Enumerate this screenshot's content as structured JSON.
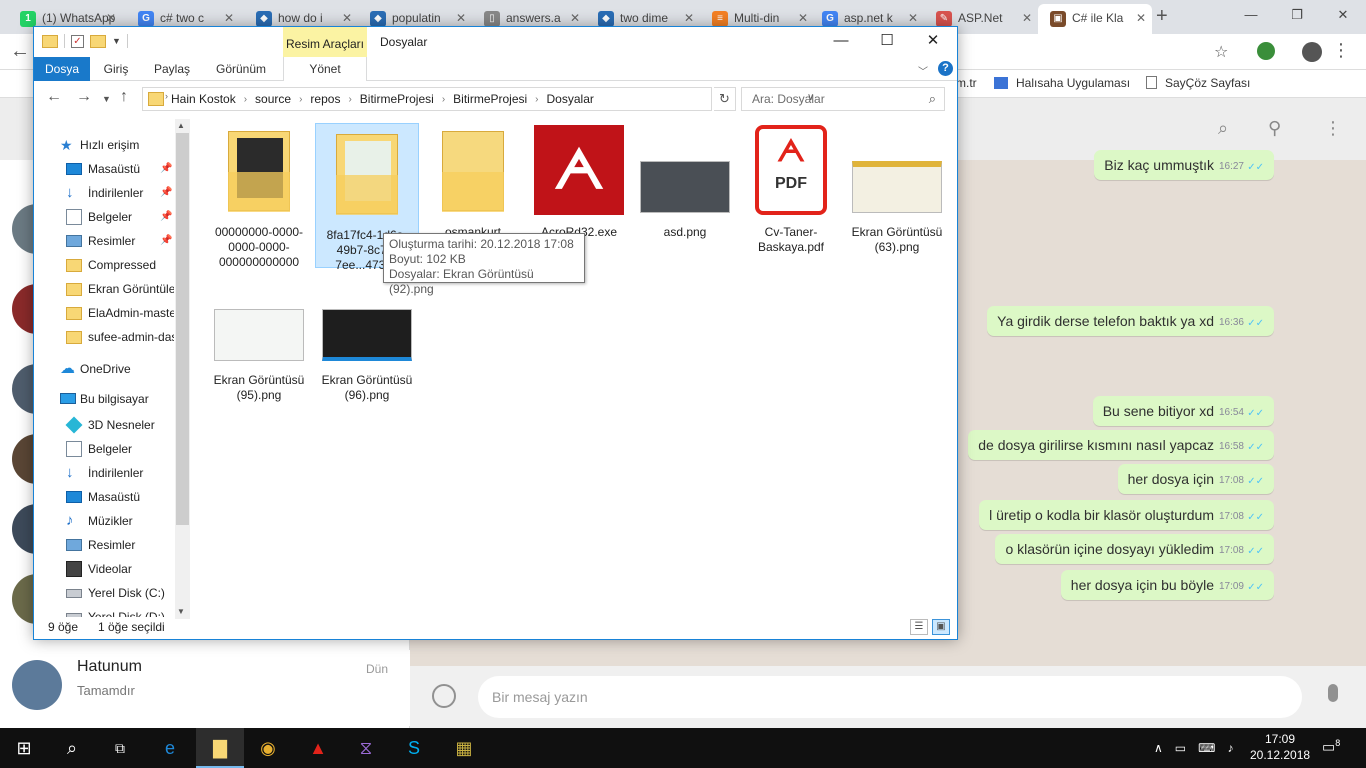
{
  "browser": {
    "tabs": [
      {
        "label": "(1) WhatsApp",
        "fav": "1",
        "color": "#25d366",
        "active": false
      },
      {
        "label": "c# two c",
        "fav": "G",
        "color": "#4285f4",
        "active": false
      },
      {
        "label": "how do i",
        "fav": "◆",
        "color": "#2a6db5",
        "active": false
      },
      {
        "label": "populatin",
        "fav": "◆",
        "color": "#2a6db5",
        "active": false
      },
      {
        "label": "answers.a",
        "fav": "▯",
        "color": "#888888",
        "active": false
      },
      {
        "label": "two dime",
        "fav": "◆",
        "color": "#2a6db5",
        "active": false
      },
      {
        "label": "Multi-din",
        "fav": "≡",
        "color": "#f48024",
        "active": false
      },
      {
        "label": "asp.net k",
        "fav": "G",
        "color": "#4285f4",
        "active": false
      },
      {
        "label": "ASP.Net",
        "fav": "✎",
        "color": "#d9534f",
        "active": false
      },
      {
        "label": "C# ile Kla",
        "fav": "▣",
        "color": "#7a4b2a",
        "active": true
      }
    ],
    "new_tab": "+",
    "bookmarks": [
      "m.tr",
      "Halısaha Uygulaması",
      "SayÇöz Sayfası"
    ]
  },
  "whatsapp": {
    "chat": {
      "name": "Hatunum",
      "preview": "Tamamdır",
      "time": "Dün"
    },
    "messages": [
      {
        "text": "Biz kaç ummuştık",
        "time": "16:27"
      },
      {
        "text": "Ya girdik derse telefon baktık ya xd",
        "time": "16:36"
      },
      {
        "text": "Bu sene bitiyor xd",
        "time": "16:54"
      },
      {
        "text": "de dosya girilirse kısmını nasıl yapcaz",
        "time": "16:58"
      },
      {
        "text": "her dosya için",
        "time": "17:08"
      },
      {
        "text": "l üretip o kodla bir klasör oluşturdum",
        "time": "17:08"
      },
      {
        "text": "o klasörün içine dosyayı yükledim",
        "time": "17:08"
      },
      {
        "text": "her dosya için bu böyle",
        "time": "17:09"
      }
    ],
    "input_placeholder": "Bir mesaj yazın"
  },
  "explorer": {
    "title": "Dosyalar",
    "context_group": "Resim Araçları",
    "ribbon_tabs": {
      "file": "Dosya",
      "home": "Giriş",
      "share": "Paylaş",
      "view": "Görünüm",
      "manage": "Yönet"
    },
    "breadcrumb": [
      "Hain Kostok",
      "source",
      "repos",
      "BitirmeProjesi",
      "BitirmeProjesi",
      "Dosyalar"
    ],
    "search_placeholder": "Ara: Dosyalar",
    "nav": [
      {
        "label": "Hızlı erişim",
        "icon": "star",
        "pinned": false
      },
      {
        "label": "Masaüstü",
        "icon": "desk",
        "pinned": true
      },
      {
        "label": "İndirilenler",
        "icon": "down",
        "pinned": true
      },
      {
        "label": "Belgeler",
        "icon": "doc",
        "pinned": true
      },
      {
        "label": "Resimler",
        "icon": "pic",
        "pinned": true
      },
      {
        "label": "Compressed",
        "icon": "folder",
        "pinned": false
      },
      {
        "label": "Ekran Görüntüleri",
        "icon": "folder",
        "pinned": false
      },
      {
        "label": "ElaAdmin-master",
        "icon": "folder",
        "pinned": false
      },
      {
        "label": "sufee-admin-dash",
        "icon": "folder",
        "pinned": false
      },
      {
        "label": "OneDrive",
        "icon": "cloud",
        "pinned": false
      },
      {
        "label": "Bu bilgisayar",
        "icon": "pc",
        "pinned": false
      },
      {
        "label": "3D Nesneler",
        "icon": "obj",
        "pinned": false
      },
      {
        "label": "Belgeler",
        "icon": "doc",
        "pinned": false
      },
      {
        "label": "İndirilenler",
        "icon": "down",
        "pinned": false
      },
      {
        "label": "Masaüstü",
        "icon": "desk",
        "pinned": false
      },
      {
        "label": "Müzikler",
        "icon": "music",
        "pinned": false
      },
      {
        "label": "Resimler",
        "icon": "pic",
        "pinned": false
      },
      {
        "label": "Videolar",
        "icon": "video",
        "pinned": false
      },
      {
        "label": "Yerel Disk (C:)",
        "icon": "disk",
        "pinned": false
      },
      {
        "label": "Yerel Disk (D:)",
        "icon": "disk",
        "pinned": false
      }
    ],
    "files": [
      {
        "name": "00000000-0000-0000-0000-000000000000",
        "kind": "folder-dark"
      },
      {
        "name": "8fa17fc4-1d6a-49b7-8c75-7ee...47320",
        "kind": "folder-shot"
      },
      {
        "name": "osmankurt",
        "kind": "folder-empty"
      },
      {
        "name": "AcroRd32.exe",
        "kind": "acro"
      },
      {
        "name": "asd.png",
        "kind": "shot-dark"
      },
      {
        "name": "Cv-Taner-Baskaya.pdf",
        "kind": "pdf"
      },
      {
        "name": "Ekran Görüntüsü (63).png",
        "kind": "shot-yellow"
      },
      {
        "name": "Ekran Görüntüsü (95).png",
        "kind": "shot-light"
      },
      {
        "name": "Ekran Görüntüsü (96).png",
        "kind": "shot-code"
      }
    ],
    "tooltip": {
      "line1": "Oluşturma tarihi: 20.12.2018 17:08",
      "line2": "Boyut: 102 KB",
      "line3": "Dosyalar: Ekran Görüntüsü (92).png"
    },
    "status": {
      "count": "9 öğe",
      "selected": "1 öğe seçildi"
    }
  },
  "taskbar": {
    "time": "17:09",
    "date": "20.12.2018",
    "notifications": "8"
  }
}
